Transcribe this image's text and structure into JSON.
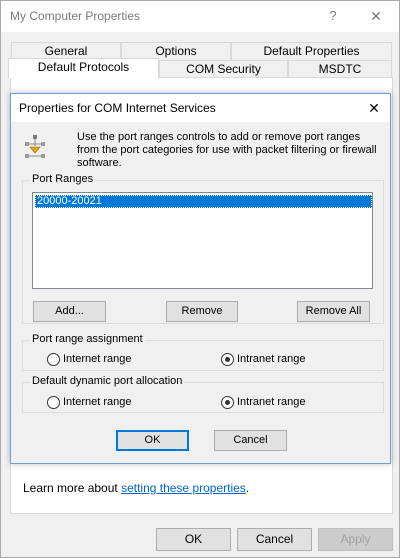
{
  "outer_window": {
    "title": "My Computer Properties",
    "help_glyph": "?",
    "close_glyph": "✕",
    "tabs_row1": [
      "General",
      "Options",
      "Default Properties"
    ],
    "tabs_row2": [
      "Default Protocols",
      "COM Security",
      "MSDTC"
    ],
    "selected_tab": "Default Protocols",
    "learn_more_prefix": "Learn more about ",
    "learn_more_link": "setting these properties",
    "learn_more_suffix": ".",
    "buttons": {
      "ok": "OK",
      "cancel": "Cancel",
      "apply": "Apply"
    }
  },
  "dialog": {
    "title": "Properties for COM Internet Services",
    "close_glyph": "✕",
    "info_icon": "network-ports-icon",
    "info_text": "Use the port ranges controls to add or remove port ranges from the port categories for use with packet filtering or firewall software.",
    "port_ranges": {
      "label": "Port Ranges",
      "items": [
        "20000-20021"
      ],
      "selected_index": 0
    },
    "buttons": {
      "add": "Add...",
      "remove": "Remove",
      "remove_all": "Remove All"
    },
    "port_range_assignment": {
      "label": "Port range assignment",
      "options": [
        "Internet range",
        "Intranet range"
      ],
      "selected": "Intranet range"
    },
    "default_dynamic_port_allocation": {
      "label": "Default dynamic port allocation",
      "options": [
        "Internet range",
        "Intranet range"
      ],
      "selected": "Intranet range"
    },
    "footer_buttons": {
      "ok": "OK",
      "cancel": "Cancel"
    }
  }
}
